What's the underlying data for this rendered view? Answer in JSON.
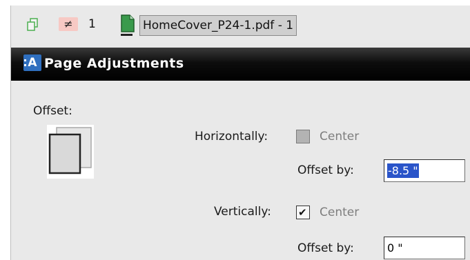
{
  "tabbar": {
    "badge_symbol": "≠",
    "count": "1",
    "file_tab": "HomeCover_P24-1.pdf - 1"
  },
  "panel": {
    "logo_letter": "A",
    "title": "Page Adjustments"
  },
  "offset": {
    "section_label": "Offset:",
    "horizontal": {
      "label": "Horizontally:",
      "center_label": "Center",
      "center_checked": false,
      "offset_label": "Offset by:",
      "offset_value": "-8.5 \""
    },
    "vertical": {
      "label": "Vertically:",
      "center_label": "Center",
      "center_checked": true,
      "offset_label": "Offset by:",
      "offset_value": "0 \""
    }
  },
  "colors": {
    "header_bg": "#000000",
    "selection": "#2a54c9",
    "badge": "#f7c9c4",
    "doc_icon": "#2e8b3e"
  },
  "icons": [
    "copy-icon",
    "not-equal-icon",
    "document-icon",
    "offset-preview-icon",
    "app-logo-icon"
  ]
}
